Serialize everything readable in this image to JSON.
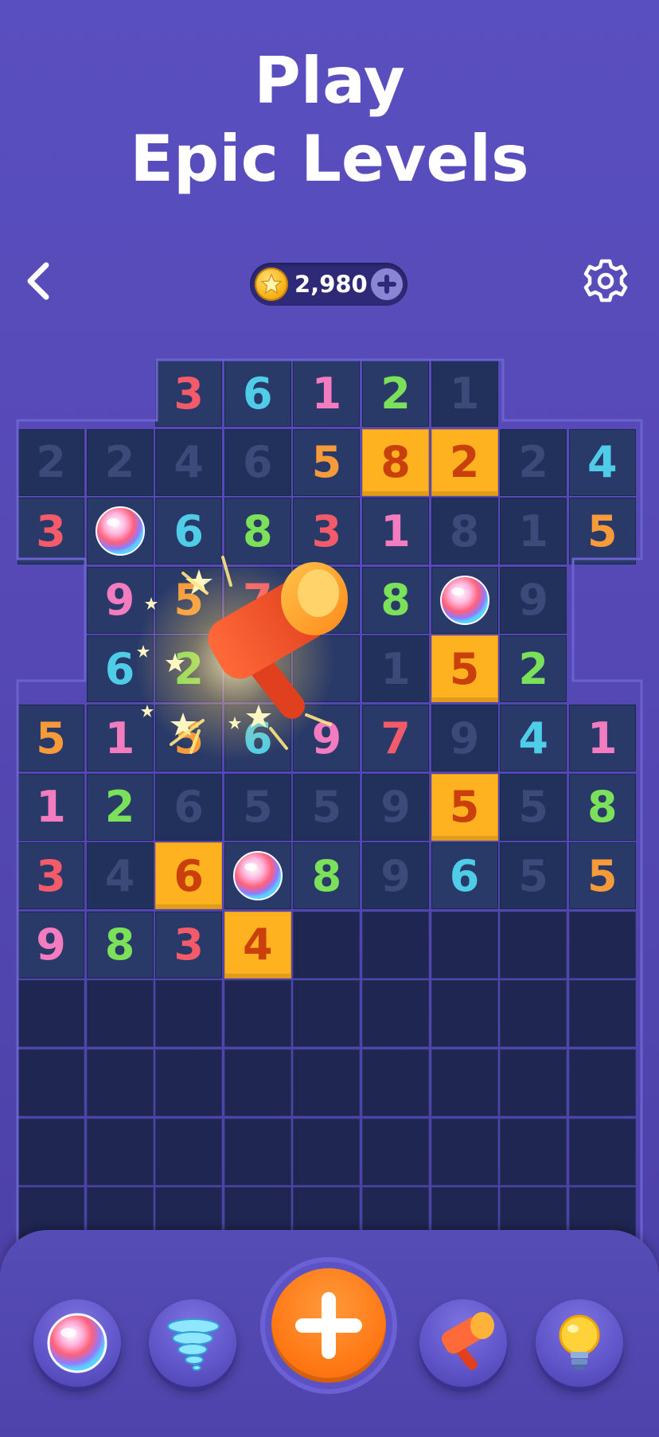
{
  "headline": {
    "line1": "Play",
    "line2": "Epic Levels"
  },
  "topbar": {
    "back_icon": "chevron-left-icon",
    "coin_icon": "star-coin-icon",
    "coins": "2,980",
    "add_coins_icon": "plus-icon",
    "settings_icon": "gear-icon"
  },
  "colors": {
    "1": "#f37bbf",
    "2": "#7be05a",
    "3": "#f35b6b",
    "4": "#4fcde8",
    "5": "#f79a3a",
    "6": "#4fcde8",
    "7": "#f35b6b",
    "8": "#7be05a",
    "9": "#f37bbf",
    "highlight_bg": "#ffb21f",
    "highlight_text": "#c9400c",
    "cell_bg": "#2a3a68",
    "cell_dim_bg": "#22305c",
    "dim_text": "#3b4a78",
    "empty_bg": "#1f2651"
  },
  "board": {
    "rows": [
      [
        "_",
        "_",
        "3",
        "6",
        "1",
        "2",
        "1~",
        "_",
        "_"
      ],
      [
        "2~",
        "2~",
        "4~",
        "6~",
        "5",
        "8*",
        "2*",
        "2~",
        "4"
      ],
      [
        "3",
        "ball",
        "6",
        "8",
        "3",
        "1",
        "8~",
        "1~",
        "5"
      ],
      [
        "_",
        "9",
        "5",
        "7",
        "",
        "8",
        "ball",
        "9~",
        "_"
      ],
      [
        "_",
        "6",
        "2",
        "",
        "",
        "1~",
        "5*",
        "2",
        "_"
      ],
      [
        "5",
        "1",
        "5",
        "6",
        "9",
        "7",
        "9~",
        "4",
        "1"
      ],
      [
        "1",
        "2",
        "6~",
        "5~",
        "5~",
        "9~",
        "5*",
        "5~",
        "8"
      ],
      [
        "3",
        "4~",
        "6*",
        "ball",
        "8",
        "9~",
        "6",
        "5~",
        "5"
      ],
      [
        "9",
        "8",
        "3",
        "4*",
        ".",
        ".",
        ".",
        ".",
        "."
      ],
      [
        ".",
        ".",
        ".",
        ".",
        ".",
        ".",
        ".",
        ".",
        "."
      ],
      [
        ".",
        ".",
        ".",
        ".",
        ".",
        ".",
        ".",
        ".",
        "."
      ],
      [
        ".",
        ".",
        ".",
        ".",
        ".",
        ".",
        ".",
        ".",
        "."
      ],
      [
        ".",
        ".",
        ".",
        ".",
        ".",
        ".",
        ".",
        ".",
        "."
      ]
    ]
  },
  "effects": {
    "hammer_icon": "hammer-icon",
    "sparkle_icon": "star-burst-icon"
  },
  "powerups": [
    {
      "name": "bubble-booster",
      "icon": "bubble-icon"
    },
    {
      "name": "tornado-booster",
      "icon": "tornado-icon"
    },
    {
      "name": "add-numbers",
      "icon": "plus-icon"
    },
    {
      "name": "hammer-booster",
      "icon": "hammer-icon"
    },
    {
      "name": "hint-booster",
      "icon": "lightbulb-icon"
    }
  ]
}
